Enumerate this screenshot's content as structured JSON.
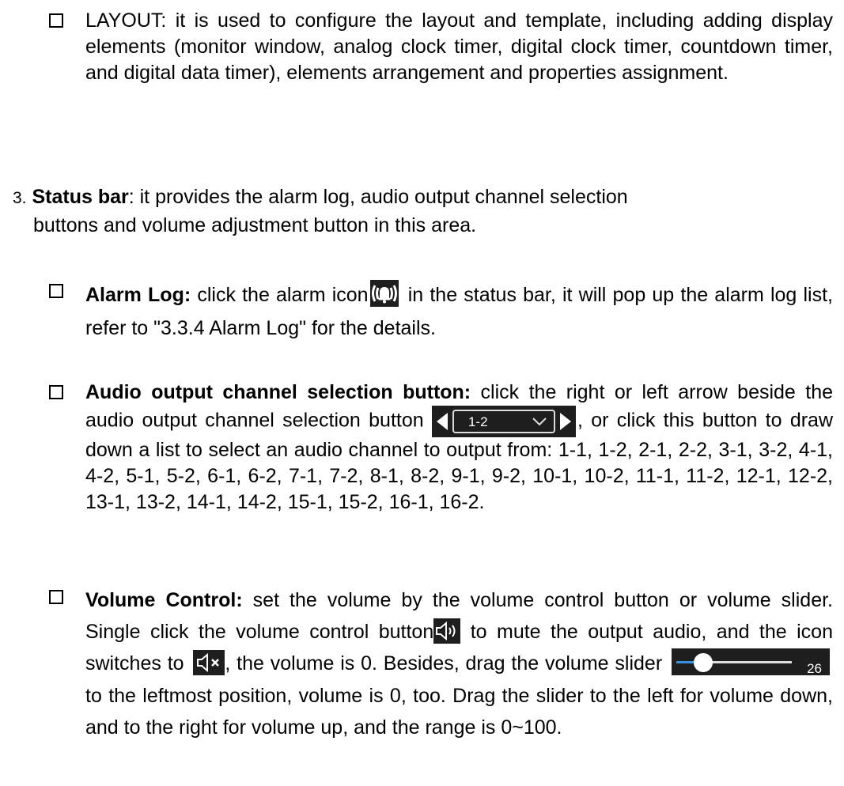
{
  "layout_bullet": {
    "text": "LAYOUT: it is used to configure the layout and template, including adding display elements (monitor window, analog clock timer, digital clock timer, countdown timer, and digital data timer), elements arrangement and properties assignment."
  },
  "status_bar": {
    "number": "3.",
    "title": "Status bar",
    "text_line1": ": it provides the alarm log, audio output channel selection",
    "text_line2": "buttons and volume adjustment button in this area."
  },
  "alarm_log": {
    "title": "Alarm Log:",
    "text_before_icon": " click the alarm icon",
    "text_after_icon": " in the status bar, it will pop up the alarm log list, refer to \"3.3.4 Alarm Log\" for the details.",
    "icon": "alarm-bell-icon"
  },
  "audio_channel": {
    "title": "Audio output channel selection button:",
    "text_before_ctl": " click the right or left arrow beside the audio output channel selection button ",
    "text_after_ctl": ", or click this button to draw down a list to select an audio channel to output from: 1-1, 1-2, 2-1, 2-2, 3-1, 3-2, 4-1, 4-2, 5-1, 5-2, 6-1, 6-2, 7-1, 7-2, 8-1, 8-2, 9-1, 9-2, 10-1, 10-2, 11-1, 11-2, 12-1, 12-2, 13-1, 13-2, 14-1, 14-2, 15-1, 15-2, 16-1, 16-2.",
    "selected_channel": "1-2"
  },
  "volume_control": {
    "title": "Volume Control:",
    "text_1": " set the volume by the volume control button or volume slider. Single click the volume control button",
    "text_2": " to mute the output audio, and the icon switches to ",
    "text_3": ", the volume is 0. Besides, drag the volume slider ",
    "text_4": " to the leftmost position, volume is 0, too. Drag the slider to the left for volume down, and to the right for volume up, and the range is 0~100.",
    "slider_value": "26",
    "slider_level": 26
  }
}
